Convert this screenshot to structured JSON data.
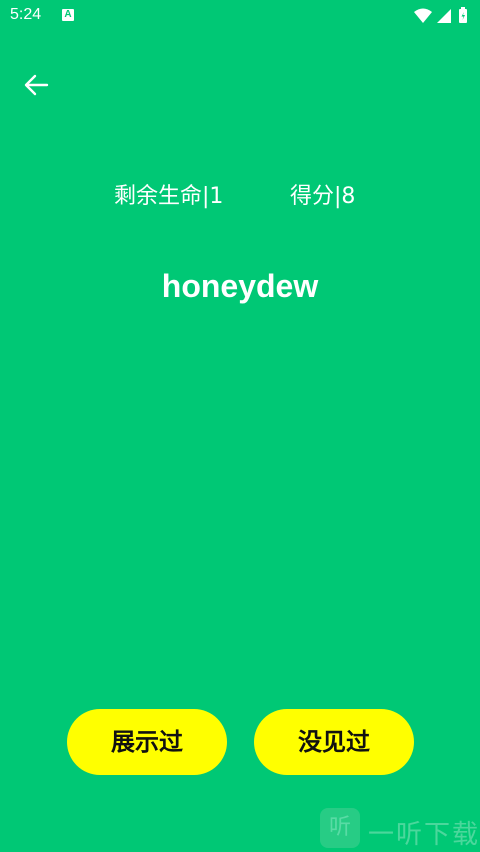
{
  "status_bar": {
    "time": "5:24",
    "notification_icon_letter": "A",
    "icons": [
      "wifi-icon",
      "cell-signal-icon",
      "battery-icon"
    ]
  },
  "nav": {
    "back_icon": "arrow-left-icon"
  },
  "game": {
    "lives_text": "剩余生命|1",
    "score_text": "得分|8",
    "word": "honeydew"
  },
  "actions": {
    "shown_label": "展示过",
    "unseen_label": "没见过"
  },
  "watermark": {
    "logo_text": "听",
    "text": "一听下载"
  },
  "colors": {
    "background": "#00c875",
    "button": "#ffff00",
    "button_text": "#111111",
    "text": "#ffffff"
  }
}
